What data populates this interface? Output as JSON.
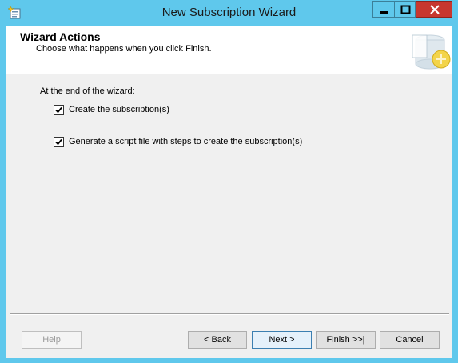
{
  "window": {
    "title": "New Subscription Wizard",
    "icon": "wizard-app-icon"
  },
  "header": {
    "title": "Wizard Actions",
    "subtitle": "Choose what happens when you click Finish.",
    "graphic": "database-publication-graphic"
  },
  "actions": {
    "group_label": "At the end of the wizard:",
    "options": [
      {
        "label": "Create the subscription(s)",
        "checked": true
      },
      {
        "label": "Generate a script file with steps to create the subscription(s)",
        "checked": true
      }
    ]
  },
  "buttons": {
    "help": "Help",
    "back": "< Back",
    "next": "Next >",
    "finish": "Finish >>|",
    "cancel": "Cancel"
  },
  "colors": {
    "titlebar": "#5fc8ec",
    "close_button": "#c7372f",
    "dialog_background": "#f0f0f0"
  }
}
